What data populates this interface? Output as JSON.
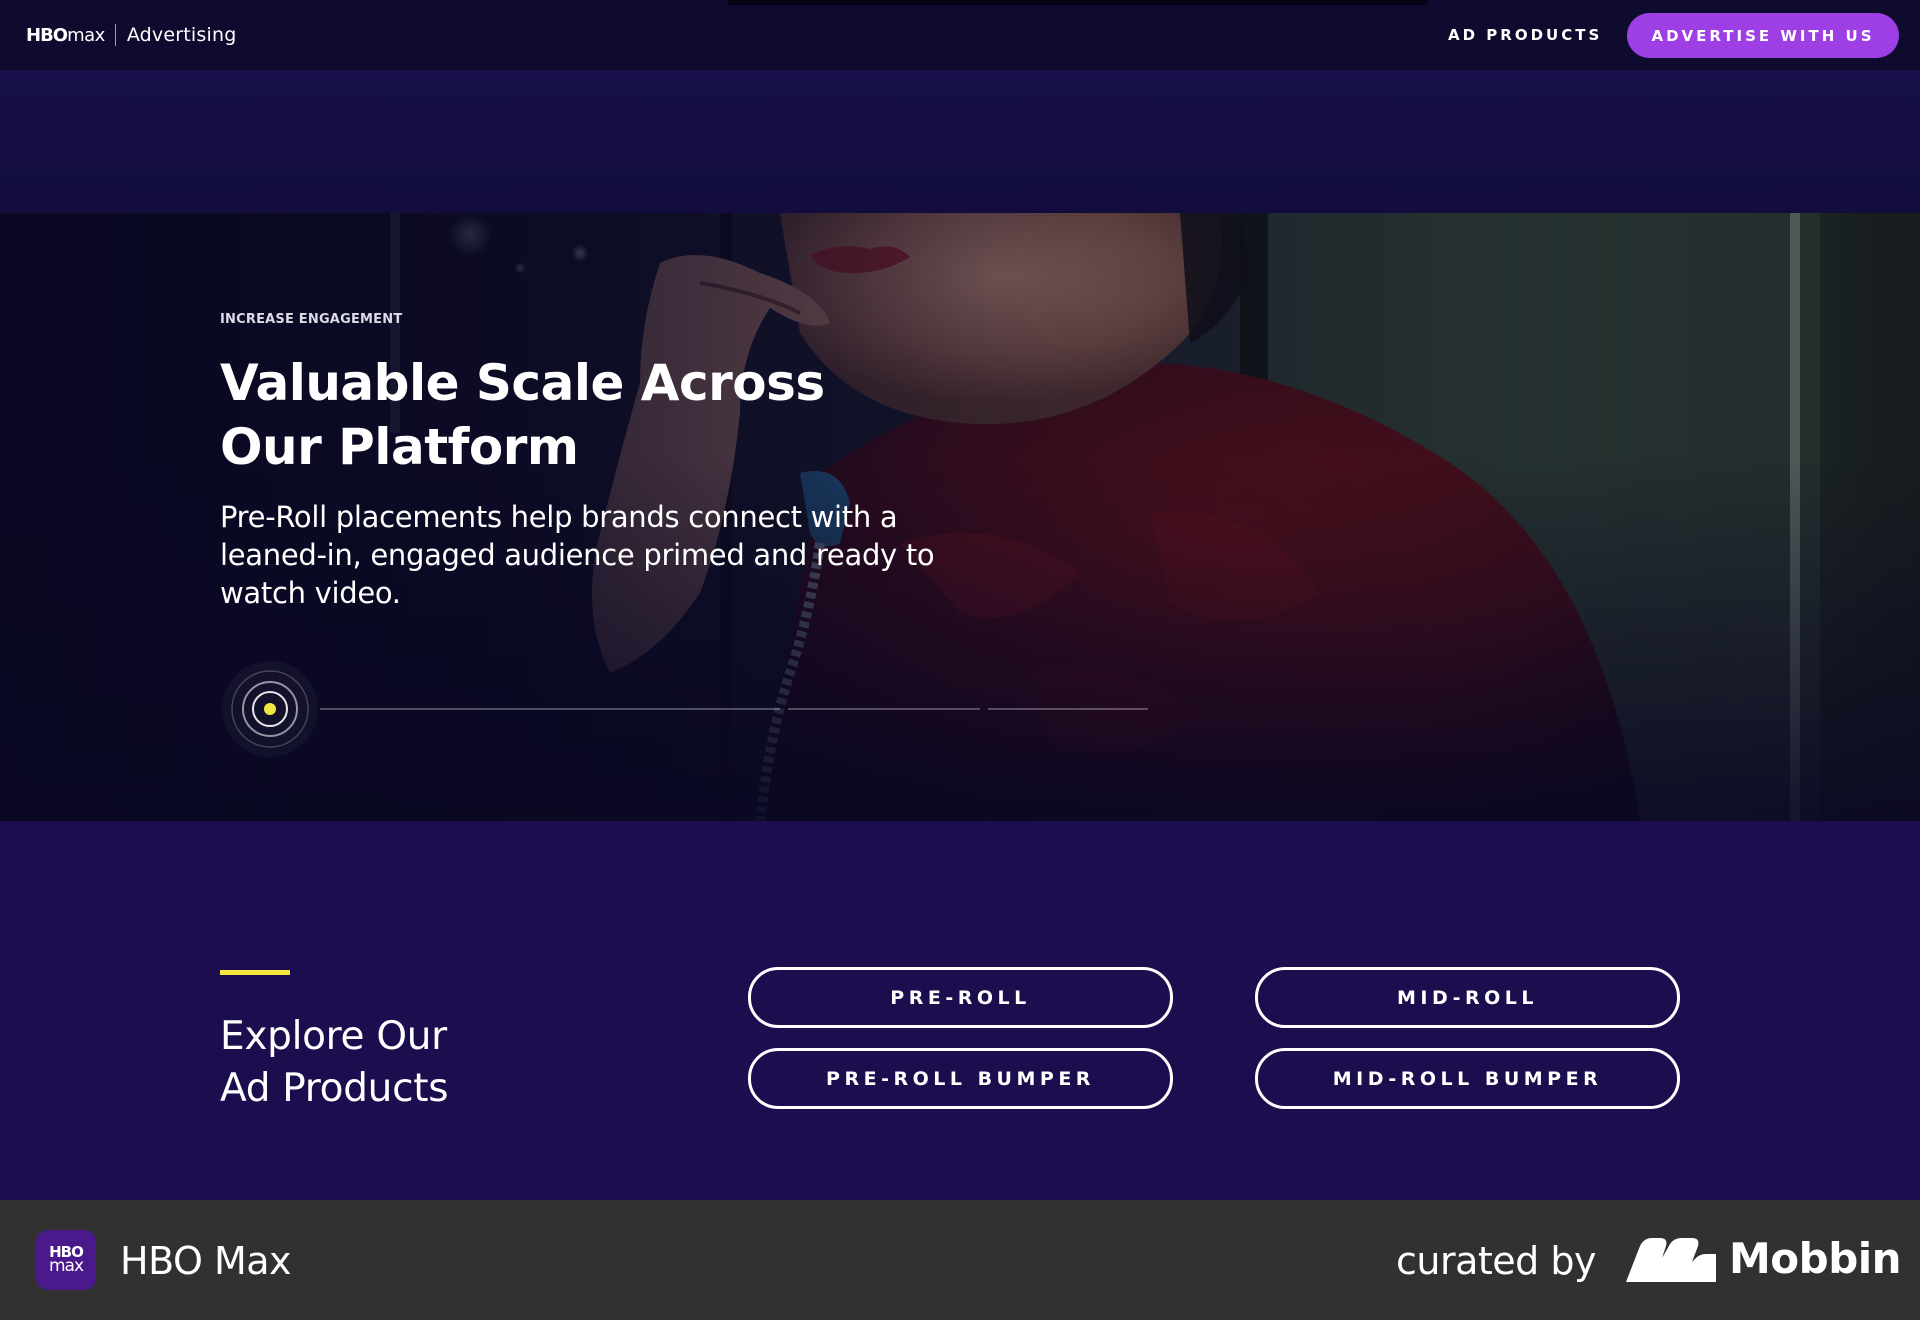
{
  "nav": {
    "logo_hbo": "HBO",
    "logo_max": "max",
    "section": "Advertising",
    "link_ad_products": "AD PRODUCTS",
    "cta": "ADVERTISE WITH US"
  },
  "hero": {
    "eyebrow": "INCREASE ENGAGEMENT",
    "title": "Valuable Scale Across Our Platform",
    "body": "Pre-Roll placements help brands connect with a leaned-in, engaged audience primed and ready to watch video.",
    "progress": {
      "active_step": 1,
      "total_steps": 4
    }
  },
  "explore": {
    "title_line1": "Explore Our",
    "title_line2": "Ad Products",
    "products": [
      "PRE-ROLL",
      "MID-ROLL",
      "PRE-ROLL BUMPER",
      "MID-ROLL BUMPER"
    ]
  },
  "footer": {
    "app_icon_line1": "HBO",
    "app_icon_line2": "max",
    "app_name": "HBO Max",
    "curated_by": "curated by",
    "brand": "Mobbin"
  },
  "colors": {
    "nav_bg": "#0e0b2f",
    "cta_purple": "#9d3fe4",
    "explore_bg": "#1b0d4e",
    "accent_yellow": "#f4e83f",
    "footer_bg": "#313131"
  },
  "icons": {
    "progress_indicator": "target-ring-icon",
    "mobbin_logo": "mobbin-logo-icon"
  }
}
